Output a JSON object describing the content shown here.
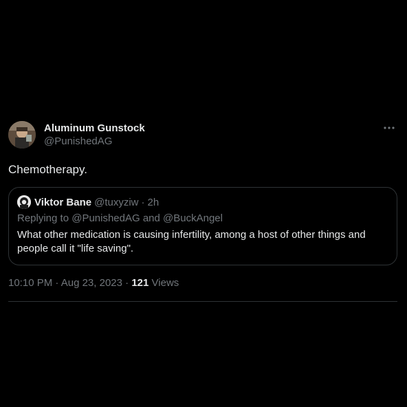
{
  "tweet": {
    "display_name": "Aluminum Gunstock",
    "handle": "@PunishedAG",
    "text": "Chemotherapy.",
    "time": "10:10 PM",
    "date": "Aug 23, 2023",
    "views_count": "121",
    "views_label": "Views",
    "more_icon": "more-horizontal-icon"
  },
  "quote": {
    "display_name": "Viktor Bane",
    "handle": "@tuxyziw",
    "separator": "·",
    "time": "2h",
    "replying_prefix": "Replying to",
    "replying_mention_1": "@PunishedAG",
    "replying_and": "and",
    "replying_mention_2": "@BuckAngel",
    "text": "What other medication is causing infertility, among a host of other things and people call it \"life saving\"."
  },
  "meta": {
    "separator": "·"
  },
  "colors": {
    "background": "#000000",
    "primary_text": "#e7e9ea",
    "secondary_text": "#71767b",
    "border": "#2f3336"
  }
}
